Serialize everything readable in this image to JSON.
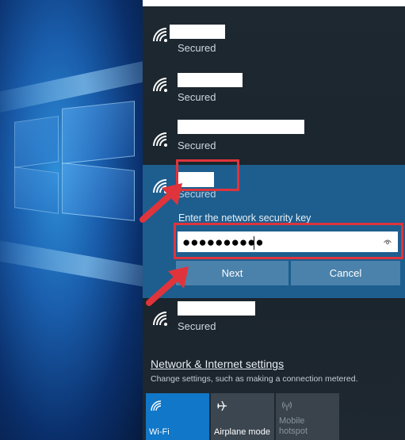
{
  "networks": [
    {
      "status": "Secured"
    },
    {
      "status": "Secured"
    },
    {
      "status": "Secured"
    },
    {
      "status": "Secured"
    },
    {
      "status": "Secured"
    }
  ],
  "expanded_network": {
    "key_prompt": "Enter the network security key",
    "key_value": "●●●●●●●●●●",
    "next_label": "Next",
    "cancel_label": "Cancel"
  },
  "settings": {
    "link": "Network & Internet settings",
    "sub": "Change settings, such as making a connection metered."
  },
  "quick_actions": [
    {
      "label": "Wi-Fi",
      "icon": "wifi-icon",
      "active": true
    },
    {
      "label": "Airplane mode",
      "icon": "airplane-icon",
      "active": false
    },
    {
      "label": "Mobile hotspot",
      "icon": "mobile-hotspot-icon",
      "active": false,
      "disabled": true
    }
  ],
  "colors": {
    "flyout_bg": "#1f2a33",
    "expanded_bg": "#1d5e8e",
    "button_bg": "#4a82ab",
    "wifi_tile": "#1177c8",
    "annotation_red": "#e0343c"
  }
}
